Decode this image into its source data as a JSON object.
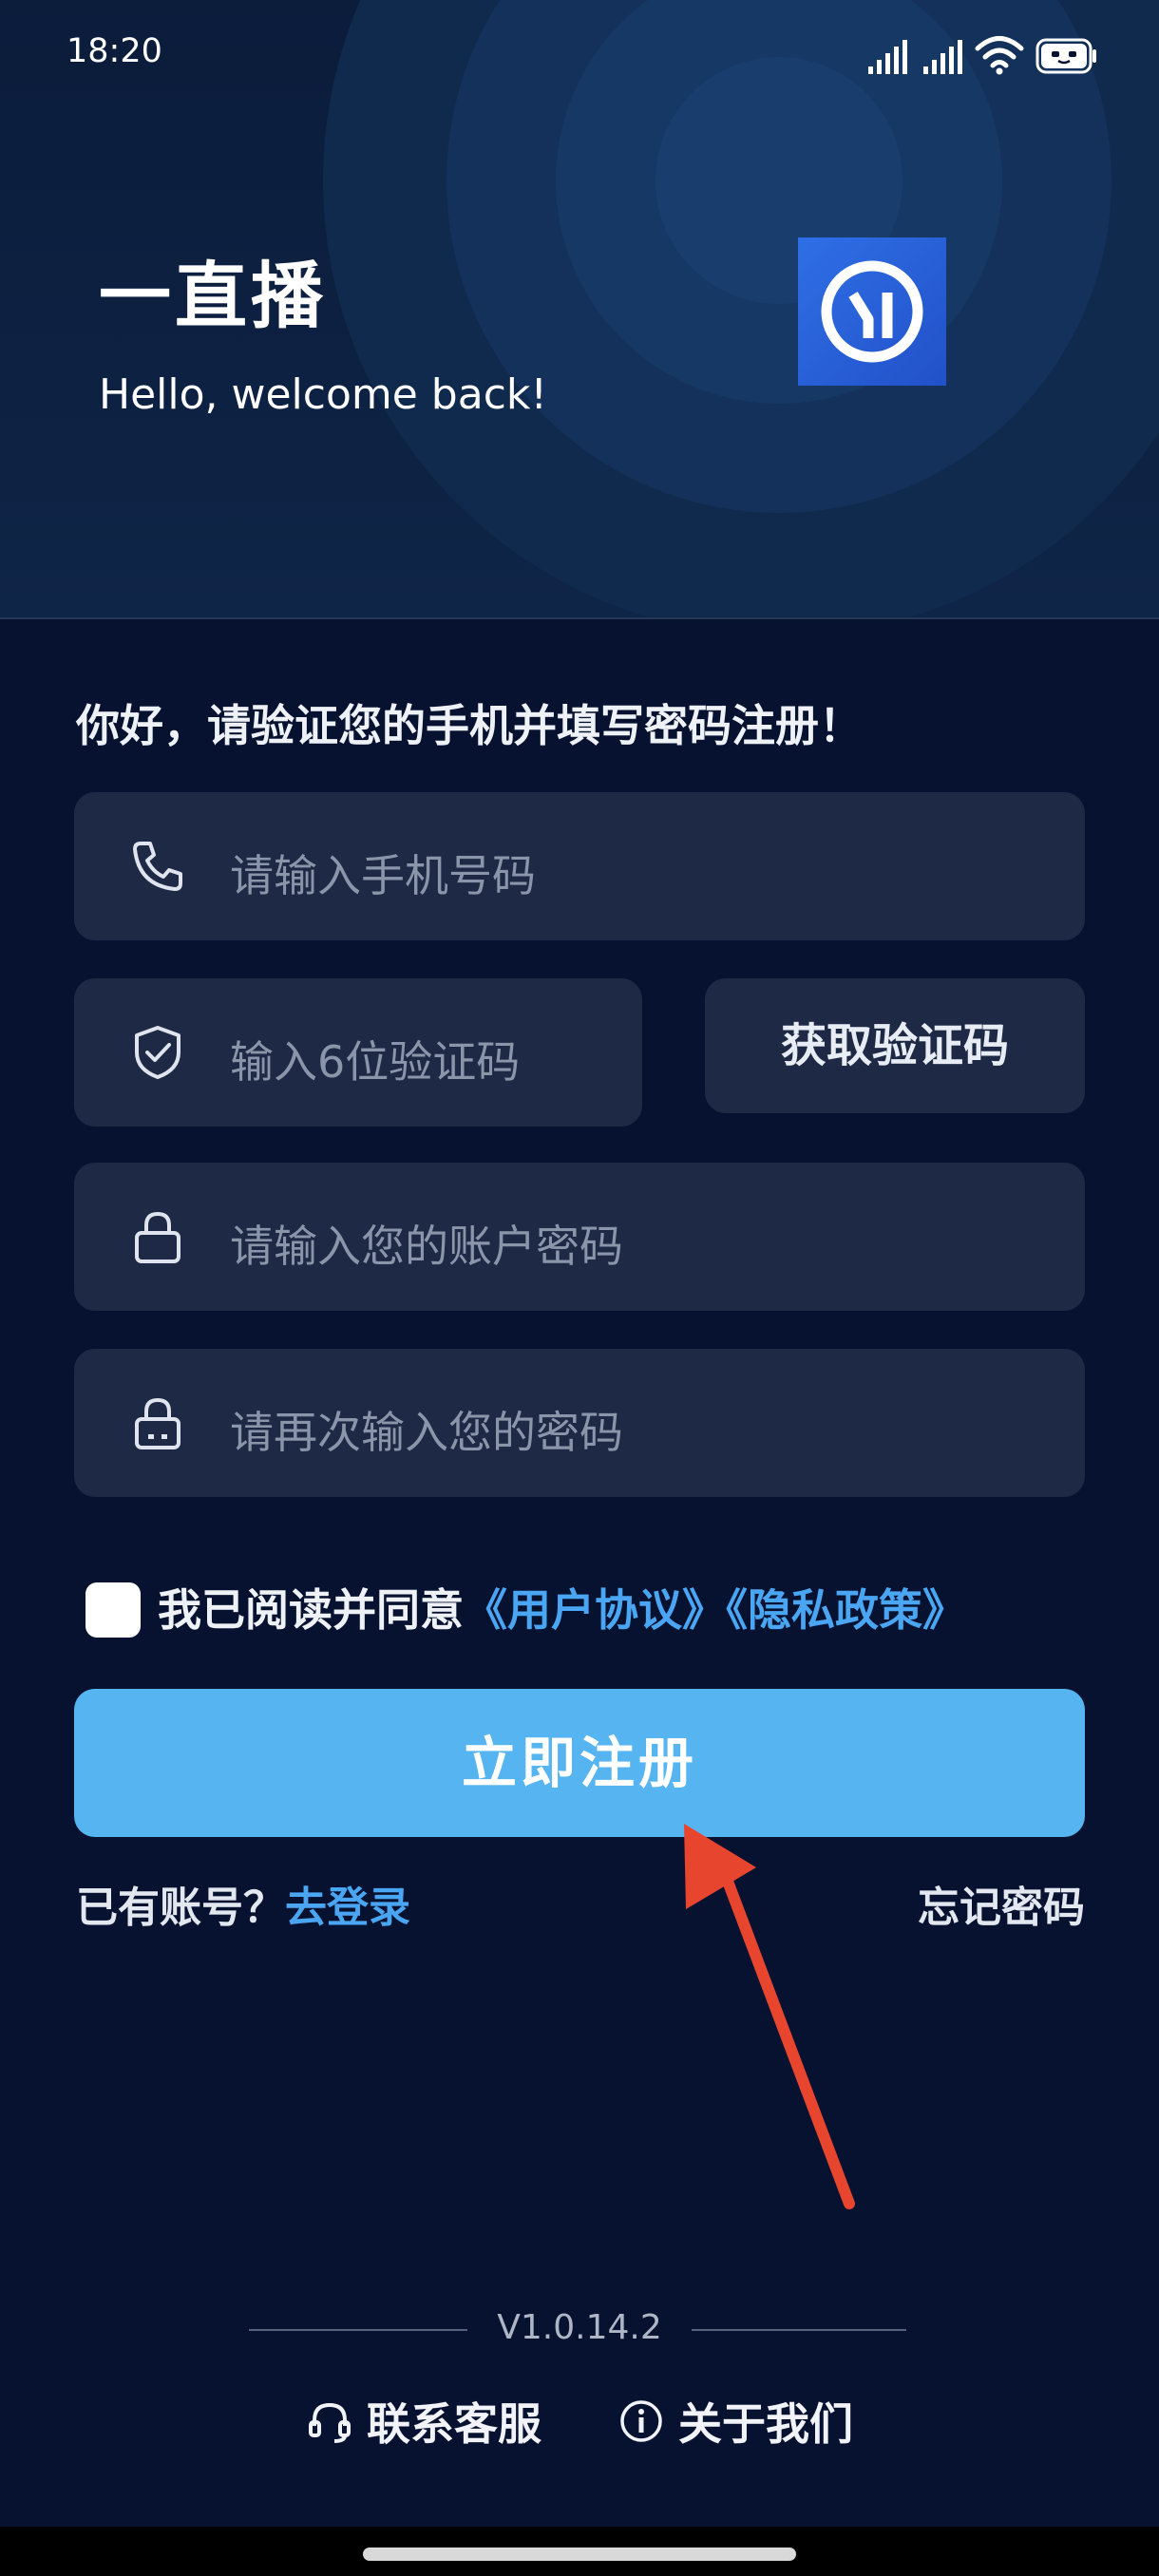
{
  "status_bar": {
    "time": "18:20"
  },
  "header": {
    "app_name": "一直播",
    "welcome": "Hello, welcome back!"
  },
  "form": {
    "prompt": "你好，请验证您的手机并填写密码注册！",
    "phone_placeholder": "请输入手机号码",
    "code_placeholder": "输入6位验证码",
    "get_code_label": "获取验证码",
    "password_placeholder": "请输入您的账户密码",
    "confirm_password_placeholder": "请再次输入您的密码"
  },
  "agreement": {
    "checked": false,
    "text": "我已阅读并同意",
    "user_agreement": "《用户协议》",
    "privacy_policy": "《隐私政策》"
  },
  "register_label": "立即注册",
  "login": {
    "have_account": "已有账号？",
    "login_link": "去登录",
    "forgot_password": "忘记密码"
  },
  "footer": {
    "version": "V1.0.14.2",
    "support": "联系客服",
    "about": "关于我们"
  },
  "icons": {
    "phone": "phone-icon",
    "code": "shield-check-icon",
    "password": "lock-icon",
    "confirm_password": "lock-dots-icon",
    "support": "headset-icon",
    "about": "info-icon"
  },
  "colors": {
    "background": "#071230",
    "field": "#1e2a45",
    "accent": "#56b4f1",
    "link": "#4aa6f2",
    "logo": "#2f6fe6",
    "annotation": "#e8452f"
  }
}
